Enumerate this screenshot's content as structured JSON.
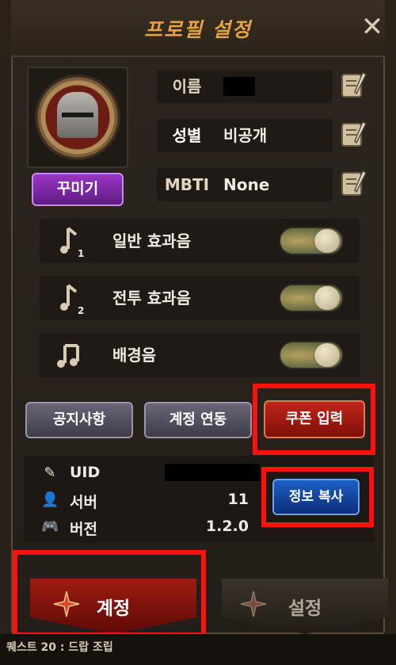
{
  "header": {
    "title": "프로필 설정",
    "close_icon": "close-icon"
  },
  "profile": {
    "decorate_label": "꾸미기",
    "fields": [
      {
        "label": "이름",
        "value": ""
      },
      {
        "label": "성별",
        "value": "비공개"
      },
      {
        "label": "MBTI",
        "value": "None"
      }
    ]
  },
  "sound": [
    {
      "label": "일반 효과음",
      "icon": "music-note-1-icon",
      "enabled": true
    },
    {
      "label": "전투 효과음",
      "icon": "music-note-2-icon",
      "enabled": true
    },
    {
      "label": "배경음",
      "icon": "music-notes-icon",
      "enabled": true
    }
  ],
  "actions": {
    "notice_label": "공지사항",
    "account_link_label": "계정 연동",
    "coupon_label": "쿠폰 입력"
  },
  "info": {
    "uid_label": "UID",
    "uid_value": "",
    "server_label": "서버",
    "server_value": "11",
    "version_label": "버전",
    "version_value": "1.2.0",
    "copy_label": "정보 복사"
  },
  "tabs": [
    {
      "label": "계정",
      "active": true
    },
    {
      "label": "설정",
      "active": false
    }
  ],
  "colors": {
    "title": "#e6a23c",
    "highlight": "#ff1010",
    "coupon_button": "#c2251a",
    "copy_button": "#1e5fc6",
    "decorate_button": "#9a35c4"
  },
  "bottom_strip_text": "퀘스트 20 : 드랍 조립"
}
